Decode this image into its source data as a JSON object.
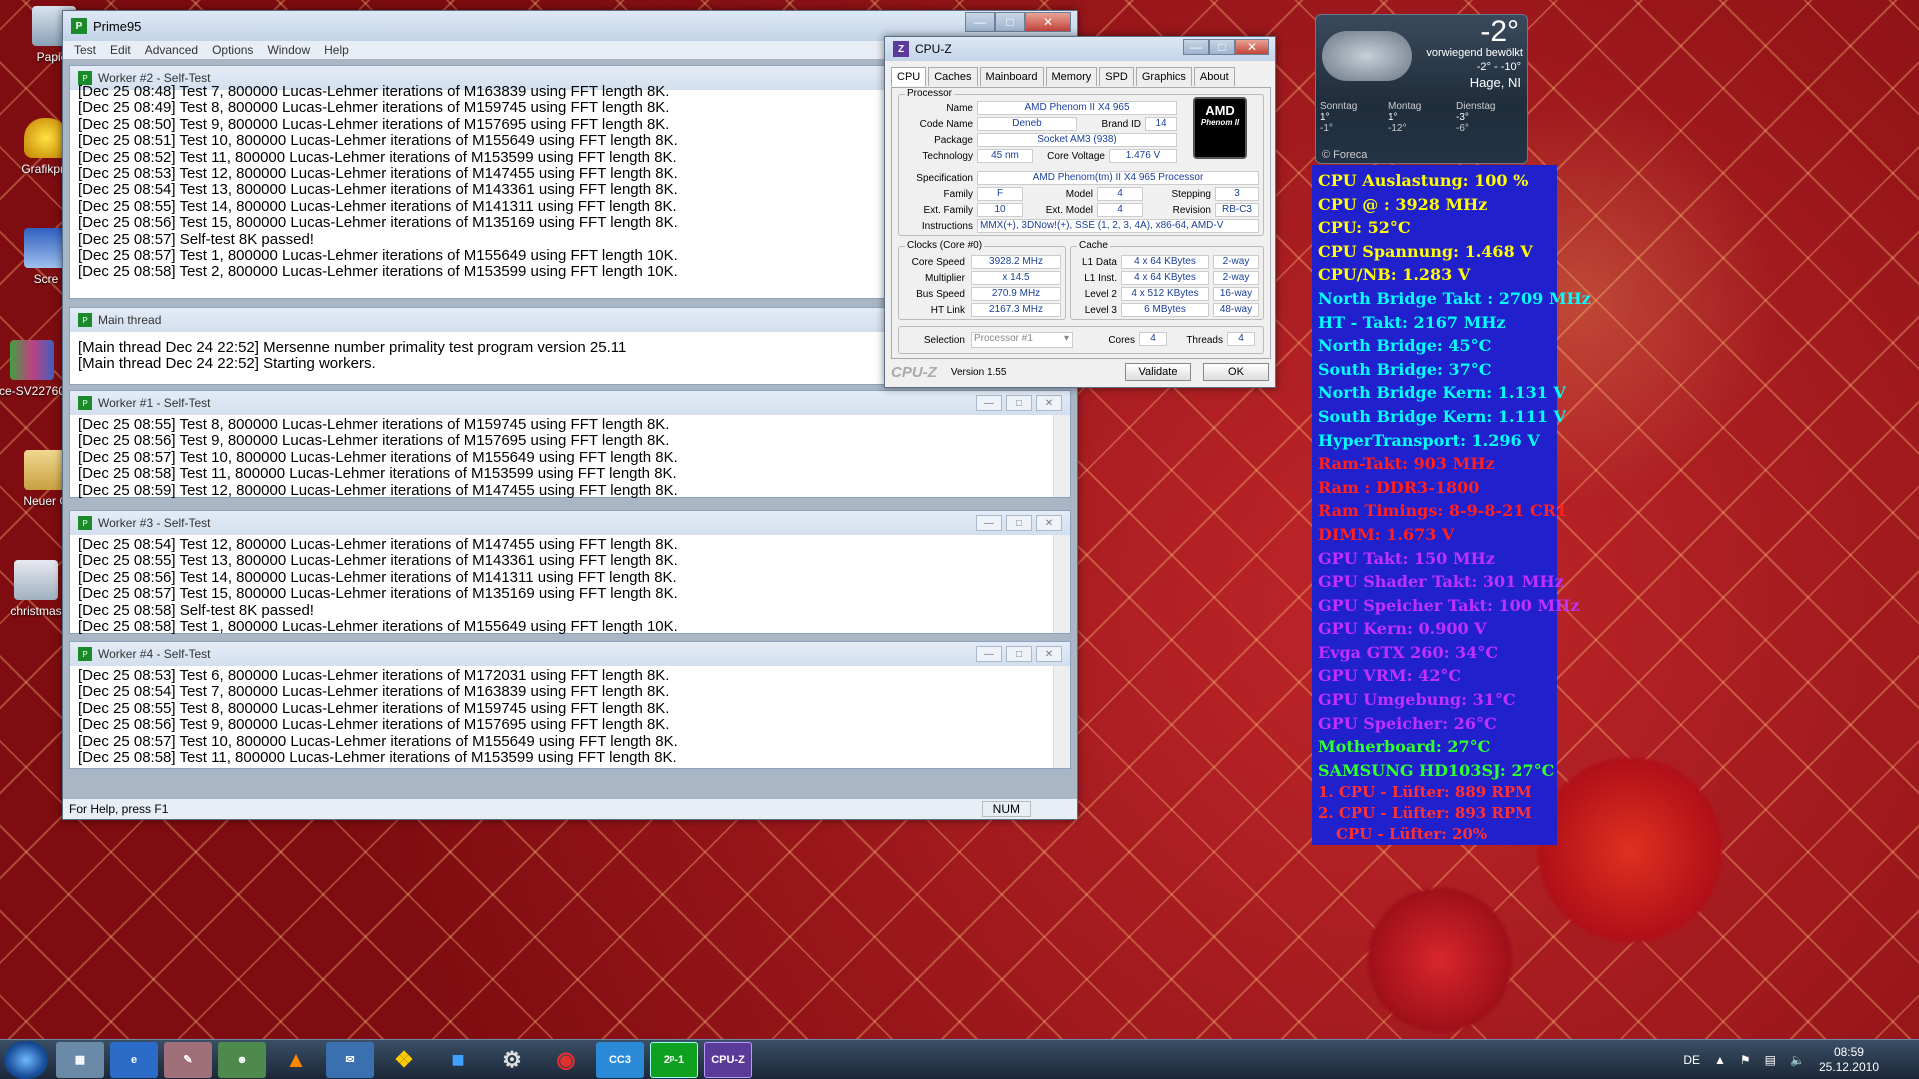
{
  "desktop": {
    "icons": [
      "Papier",
      "Grafikpro",
      "Scre",
      "ce-SV22760",
      "Neuer O",
      "christmas"
    ]
  },
  "prime95": {
    "title": "Prime95",
    "menu": [
      "Test",
      "Edit",
      "Advanced",
      "Options",
      "Window",
      "Help"
    ],
    "worker2": {
      "title": "Worker #2 - Self-Test",
      "lines": [
        "[Dec 25 08:48] Test 7, 800000 Lucas-Lehmer iterations of M163839 using FFT length 8K.",
        "[Dec 25 08:49] Test 8, 800000 Lucas-Lehmer iterations of M159745 using FFT length 8K.",
        "[Dec 25 08:50] Test 9, 800000 Lucas-Lehmer iterations of M157695 using FFT length 8K.",
        "[Dec 25 08:51] Test 10, 800000 Lucas-Lehmer iterations of M155649 using FFT length 8K.",
        "[Dec 25 08:52] Test 11, 800000 Lucas-Lehmer iterations of M153599 using FFT length 8K.",
        "[Dec 25 08:53] Test 12, 800000 Lucas-Lehmer iterations of M147455 using FFT length 8K.",
        "[Dec 25 08:54] Test 13, 800000 Lucas-Lehmer iterations of M143361 using FFT length 8K.",
        "[Dec 25 08:55] Test 14, 800000 Lucas-Lehmer iterations of M141311 using FFT length 8K.",
        "[Dec 25 08:56] Test 15, 800000 Lucas-Lehmer iterations of M135169 using FFT length 8K.",
        "[Dec 25 08:57] Self-test 8K passed!",
        "[Dec 25 08:57] Test 1, 800000 Lucas-Lehmer iterations of M155649 using FFT length 10K.",
        "[Dec 25 08:58] Test 2, 800000 Lucas-Lehmer iterations of M153599 using FFT length 10K."
      ]
    },
    "main": {
      "title": "Main thread",
      "lines": [
        "[Main thread Dec 24 22:52] Mersenne number primality test program version 25.11",
        "[Main thread Dec 24 22:52] Starting workers."
      ]
    },
    "worker1": {
      "title": "Worker #1 - Self-Test",
      "lines": [
        "[Dec 25 08:55] Test 8, 800000 Lucas-Lehmer iterations of M159745 using FFT length 8K.",
        "[Dec 25 08:56] Test 9, 800000 Lucas-Lehmer iterations of M157695 using FFT length 8K.",
        "[Dec 25 08:57] Test 10, 800000 Lucas-Lehmer iterations of M155649 using FFT length 8K.",
        "[Dec 25 08:58] Test 11, 800000 Lucas-Lehmer iterations of M153599 using FFT length 8K.",
        "[Dec 25 08:59] Test 12, 800000 Lucas-Lehmer iterations of M147455 using FFT length 8K."
      ]
    },
    "worker3": {
      "title": "Worker #3 - Self-Test",
      "lines": [
        "[Dec 25 08:54] Test 12, 800000 Lucas-Lehmer iterations of M147455 using FFT length 8K.",
        "[Dec 25 08:55] Test 13, 800000 Lucas-Lehmer iterations of M143361 using FFT length 8K.",
        "[Dec 25 08:56] Test 14, 800000 Lucas-Lehmer iterations of M141311 using FFT length 8K.",
        "[Dec 25 08:57] Test 15, 800000 Lucas-Lehmer iterations of M135169 using FFT length 8K.",
        "[Dec 25 08:58] Self-test 8K passed!",
        "[Dec 25 08:58] Test 1, 800000 Lucas-Lehmer iterations of M155649 using FFT length 10K."
      ]
    },
    "worker4": {
      "title": "Worker #4 - Self-Test",
      "lines": [
        "[Dec 25 08:53] Test 6, 800000 Lucas-Lehmer iterations of M172031 using FFT length 8K.",
        "[Dec 25 08:54] Test 7, 800000 Lucas-Lehmer iterations of M163839 using FFT length 8K.",
        "[Dec 25 08:55] Test 8, 800000 Lucas-Lehmer iterations of M159745 using FFT length 8K.",
        "[Dec 25 08:56] Test 9, 800000 Lucas-Lehmer iterations of M157695 using FFT length 8K.",
        "[Dec 25 08:57] Test 10, 800000 Lucas-Lehmer iterations of M155649 using FFT length 8K.",
        "[Dec 25 08:58] Test 11, 800000 Lucas-Lehmer iterations of M153599 using FFT length 8K."
      ]
    },
    "status": "For Help, press F1",
    "num": "NUM"
  },
  "cpuz": {
    "title": "CPU-Z",
    "tabs": [
      "CPU",
      "Caches",
      "Mainboard",
      "Memory",
      "SPD",
      "Graphics",
      "About"
    ],
    "processor_label": "Processor",
    "name_label": "Name",
    "name": "AMD Phenom II X4 965",
    "codename_label": "Code Name",
    "codename": "Deneb",
    "brandid_label": "Brand ID",
    "brandid": "14",
    "package_label": "Package",
    "package": "Socket AM3 (938)",
    "tech_label": "Technology",
    "tech": "45 nm",
    "voltage_label": "Core Voltage",
    "voltage": "1.476 V",
    "spec_label": "Specification",
    "spec": "AMD Phenom(tm) II X4 965 Processor",
    "family_label": "Family",
    "family": "F",
    "model_label": "Model",
    "model": "4",
    "stepping_label": "Stepping",
    "stepping": "3",
    "extfamily_label": "Ext. Family",
    "extfamily": "10",
    "extmodel_label": "Ext. Model",
    "extmodel": "4",
    "revision_label": "Revision",
    "revision": "RB-C3",
    "instr_label": "Instructions",
    "instr": "MMX(+), 3DNow!(+), SSE (1, 2, 3, 4A), x86-64, AMD-V",
    "clocks_label": "Clocks (Core #0)",
    "corespeed_label": "Core Speed",
    "corespeed": "3928.2 MHz",
    "mult_label": "Multiplier",
    "mult": "x 14.5",
    "bus_label": "Bus Speed",
    "bus": "270.9 MHz",
    "ht_label": "HT Link",
    "ht": "2167.3 MHz",
    "cache_label": "Cache",
    "l1d_label": "L1 Data",
    "l1d": "4 x 64 KBytes",
    "l1d_way": "2-way",
    "l1i_label": "L1 Inst.",
    "l1i": "4 x 64 KBytes",
    "l1i_way": "2-way",
    "l2_label": "Level 2",
    "l2": "4 x 512 KBytes",
    "l2_way": "16-way",
    "l3_label": "Level 3",
    "l3": "6 MBytes",
    "l3_way": "48-way",
    "selection_label": "Selection",
    "selection": "Processor #1",
    "cores_label": "Cores",
    "cores": "4",
    "threads_label": "Threads",
    "threads": "4",
    "brand": "CPU-Z",
    "version": "Version 1.55",
    "validate": "Validate",
    "ok": "OK",
    "logo_text": "AMD",
    "logo_sub": "Phenom II"
  },
  "weather": {
    "temp": "-2°",
    "desc": "vorwiegend bewölkt",
    "range": "-2° - -10°",
    "city": "Hage, NI",
    "days": [
      {
        "name": "Sonntag",
        "hi": "1°",
        "lo": "-1°"
      },
      {
        "name": "Montag",
        "hi": "1°",
        "lo": "-12°"
      },
      {
        "name": "Dienstag",
        "hi": "-3°",
        "lo": "-6°"
      }
    ],
    "credit": "© Foreca"
  },
  "sensors": [
    {
      "t": "CPU Auslastung: 100 %",
      "c": "#ffff00"
    },
    {
      "t": "CPU @ : 3928 MHz",
      "c": "#ffff00"
    },
    {
      "t": "CPU: 52°C",
      "c": "#ffff00"
    },
    {
      "t": "CPU Spannung: 1.468 V",
      "c": "#ffff00"
    },
    {
      "t": "CPU/NB: 1.283 V",
      "c": "#ffff00"
    },
    {
      "t": "North Bridge Takt : 2709 MHz",
      "c": "#00ffff"
    },
    {
      "t": "HT - Takt: 2167 MHz",
      "c": "#00ffff"
    },
    {
      "t": "North Bridge: 45°C",
      "c": "#00ffff"
    },
    {
      "t": "South Bridge: 37°C",
      "c": "#00ffff"
    },
    {
      "t": "North Bridge Kern: 1.131 V",
      "c": "#00ffff"
    },
    {
      "t": "South Bridge Kern: 1.111 V",
      "c": "#00ffff"
    },
    {
      "t": "HyperTransport: 1.296 V",
      "c": "#00ffff"
    },
    {
      "t": "Ram-Takt: 903 MHz",
      "c": "#ff2020"
    },
    {
      "t": "Ram : DDR3-1800",
      "c": "#ff2020"
    },
    {
      "t": "Ram Timings: 8-9-8-21 CR1",
      "c": "#ff2020"
    },
    {
      "t": "DIMM: 1.673 V",
      "c": "#ff2020"
    },
    {
      "t": "GPU Takt: 150 MHz",
      "c": "#c030ff"
    },
    {
      "t": "GPU Shader Takt: 301 MHz",
      "c": "#c030ff"
    },
    {
      "t": "GPU Speicher Takt: 100 MHz",
      "c": "#c030ff"
    },
    {
      "t": "GPU Kern: 0.900 V",
      "c": "#c030ff"
    },
    {
      "t": "Evga GTX 260: 34°C",
      "c": "#c030ff"
    },
    {
      "t": "GPU VRM: 42°C",
      "c": "#c030ff"
    },
    {
      "t": "GPU Umgebung: 31°C",
      "c": "#c030ff"
    },
    {
      "t": "GPU Speicher: 26°C",
      "c": "#c030ff"
    },
    {
      "t": "Motherboard: 27°C",
      "c": "#30ff30"
    },
    {
      "t": "SAMSUNG HD103SJ: 27°C",
      "c": "#30ff30"
    },
    {
      "t": "1. CPU - Lüfter: 889 RPM",
      "c": "#ff3030"
    },
    {
      "t": "2. CPU - Lüfter: 893 RPM",
      "c": "#ff3030"
    },
    {
      "t": "CPU - Lüfter: 20%",
      "c": "#ff3030"
    }
  ],
  "taskbar": {
    "lang": "DE",
    "time": "08:59",
    "date": "25.12.2010",
    "apps": [
      "explorer",
      "ie",
      "paint",
      "people",
      "vlc",
      "outlook",
      "scripts",
      "3d",
      "steam",
      "maxthon",
      "CC3",
      "prime95",
      "CPU-Z"
    ]
  }
}
